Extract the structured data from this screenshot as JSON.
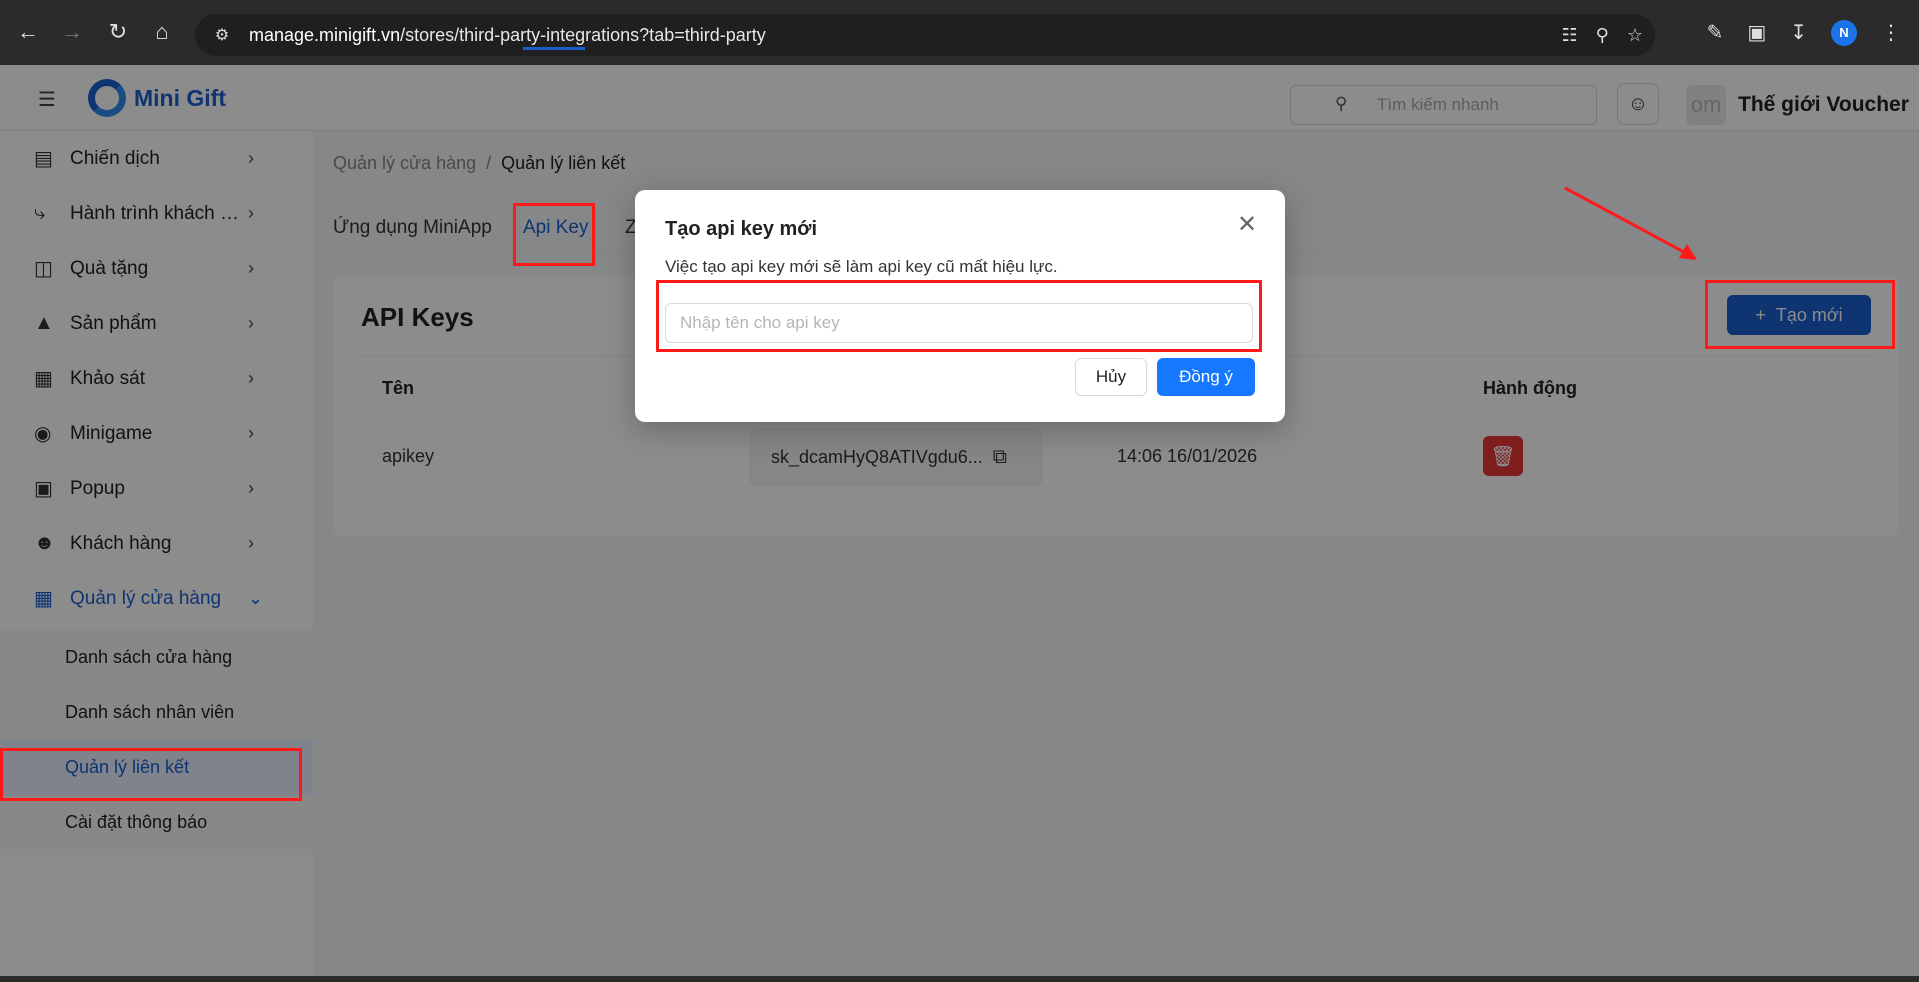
{
  "browser": {
    "url_host": "manage.minigift.vn",
    "url_path": "/stores/third-party-integrations?tab=third-party",
    "profile_initial": "N"
  },
  "header": {
    "brand": "Mini Gift",
    "search_placeholder": "Tìm kiếm nhanh",
    "store_avatar_text": "om",
    "store_name": "Thế giới Voucher"
  },
  "sidebar": {
    "items": [
      {
        "label": "Chiến dịch"
      },
      {
        "label": "Hành trình khách hàng"
      },
      {
        "label": "Quà tặng"
      },
      {
        "label": "Sản phẩm"
      },
      {
        "label": "Khảo sát"
      },
      {
        "label": "Minigame"
      },
      {
        "label": "Popup"
      },
      {
        "label": "Khách hàng"
      },
      {
        "label": "Quản lý cửa hàng"
      }
    ],
    "sub_items": [
      {
        "label": "Danh sách cửa hàng"
      },
      {
        "label": "Danh sách nhân viên"
      },
      {
        "label": "Quản lý liên kết"
      },
      {
        "label": "Cài đặt thông báo"
      }
    ]
  },
  "breadcrumb": {
    "parent": "Quản lý cửa hàng",
    "separator": "/",
    "current": "Quản lý liên kết"
  },
  "tabs": [
    {
      "label": "Ứng dụng MiniApp"
    },
    {
      "label": "Api Key"
    },
    {
      "label": "Z"
    }
  ],
  "card": {
    "title": "API Keys",
    "create_label": "Tạo mới",
    "columns": [
      "Tên",
      "Hành động"
    ],
    "rows": [
      {
        "name": "apikey",
        "key": "sk_dcamHyQ8ATIVgdu6...",
        "created": "14:06 16/01/2026"
      }
    ]
  },
  "modal": {
    "title": "Tạo api key mới",
    "description": "Việc tạo api key mới sẽ làm api key cũ mất hiệu lực.",
    "input_placeholder": "Nhập tên cho api key",
    "cancel_label": "Hủy",
    "ok_label": "Đồng ý"
  },
  "colors": {
    "primary": "#1b5fcf",
    "ok_button": "#1677ff",
    "danger": "#e53935",
    "annotation": "#ff1a1a"
  }
}
